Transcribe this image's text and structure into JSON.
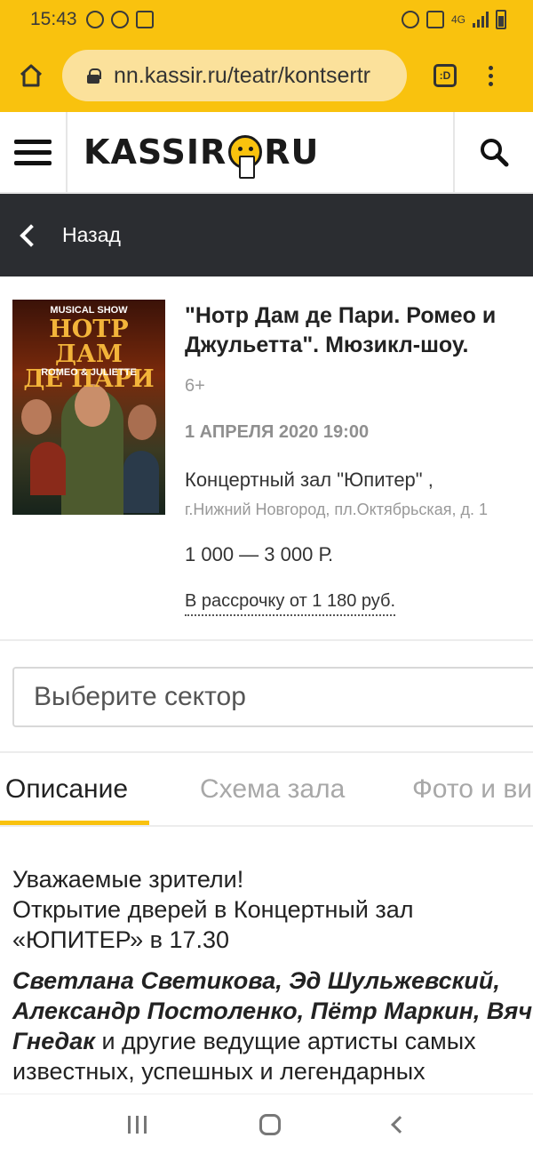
{
  "status_bar": {
    "time": "15:43",
    "network": "4G",
    "left_icons": [
      "viber-icon",
      "vpn-icon",
      "square-notification-icon"
    ],
    "right_icons": [
      "alarm-icon",
      "mute-icon",
      "signal-icon",
      "battery-icon"
    ]
  },
  "browser": {
    "url": "nn.kassir.ru/teatr/kontsertr",
    "tabs_label": ":D"
  },
  "site": {
    "logo_left": "KASSIR",
    "logo_right": "RU"
  },
  "back_bar": {
    "label": "Назад"
  },
  "event": {
    "poster": {
      "top": "MUSICAL SHOW",
      "title_line1": "НОТР ДАМ",
      "title_line2": "ДЕ ПАРИ",
      "subtitle": "ROMEO & JULIETTE"
    },
    "title": "\"Нотр Дам де Пари. Ромео и Джульетта\". Мюзикл-шоу.",
    "age": "6+",
    "date": "1 АПРЕЛЯ 2020 19:00",
    "venue": "Концертный зал \"Юпитер\" ,",
    "address": "г.Нижний Новгород, пл.Октябрьская, д. 1",
    "price": "1 000 — 3 000 Р.",
    "installment": "В рассрочку от 1 180 руб."
  },
  "sector_select": {
    "placeholder": "Выберите сектор"
  },
  "tabs": [
    {
      "label": "Описание",
      "active": true
    },
    {
      "label": "Схема зала",
      "active": false
    },
    {
      "label": "Фото и ви",
      "active": false
    }
  ],
  "description": {
    "p1_line1": "Уважаемые зрители!",
    "p1_line2": "Открытие дверей в Концертный зал",
    "p1_line3": "«ЮПИТЕР» в 17.30",
    "p2_line1": "Светлана Светикова, Эд Шульжевский,",
    "p2_line2": "Александр Постоленко, Пётр Маркин, Вячес",
    "p2_line3_bold": "Гнедак",
    "p2_line3_rest": " и другие ведущие артисты самых",
    "p2_line4": "известных, успешных и легендарных"
  },
  "colors": {
    "accent": "#f9c20e",
    "dark_bar": "#2b2d31"
  }
}
